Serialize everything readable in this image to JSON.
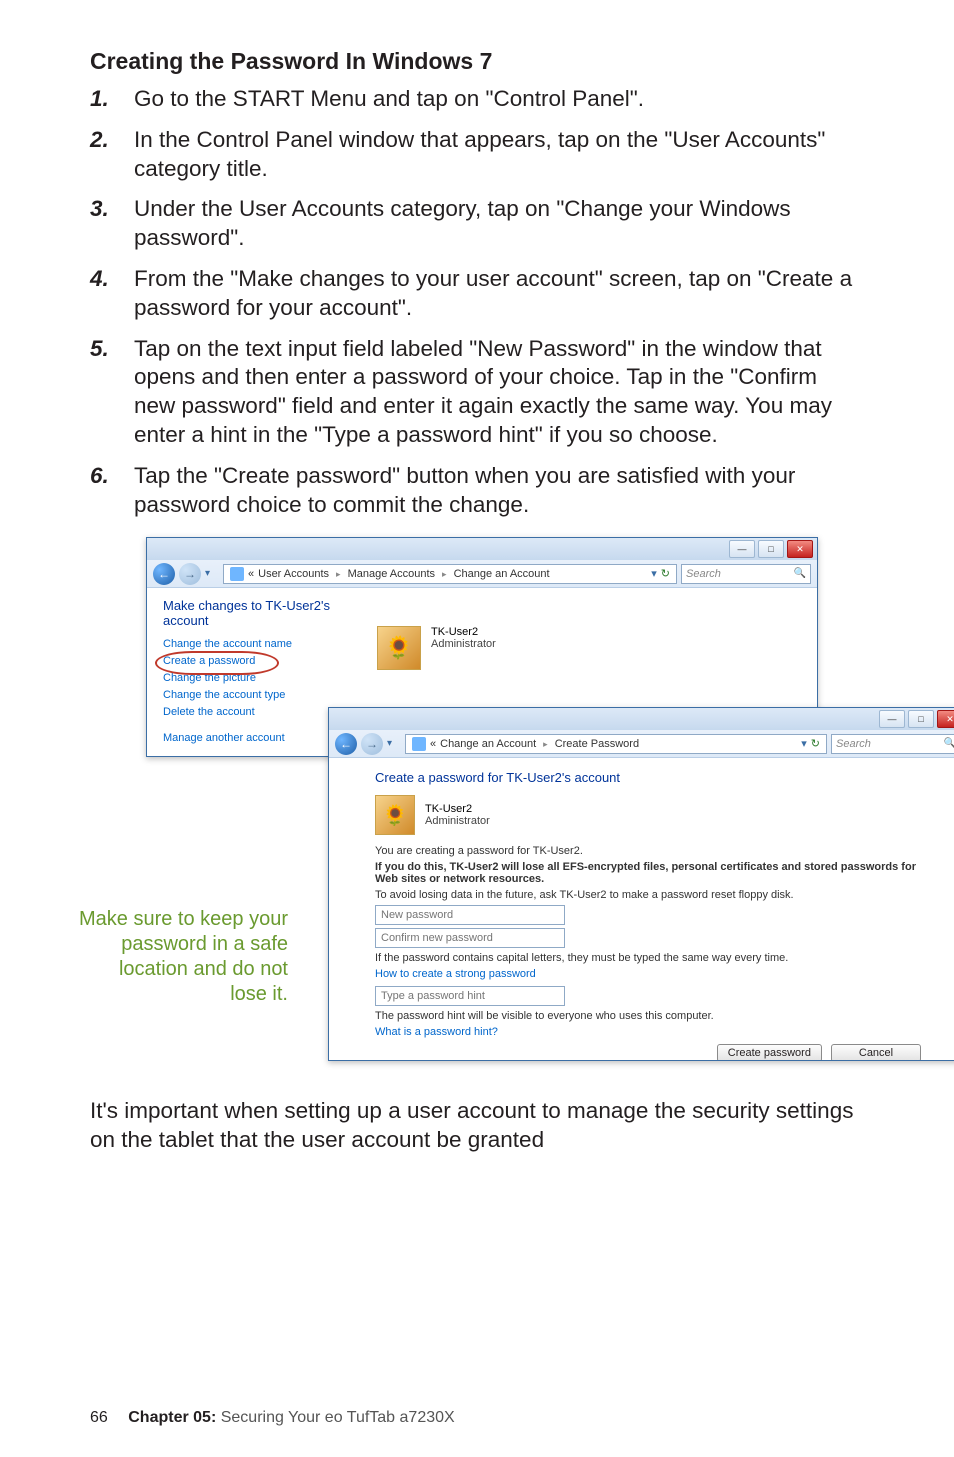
{
  "heading": "Creating the Password In Windows 7",
  "steps": [
    "Go to the START Menu and tap on \"Control Panel\".",
    "In the Control Panel window that appears, tap on the \"User Accounts\" category title.",
    "Under the User Accounts category, tap on \"Change your Windows password\".",
    "From the \"Make changes to your user account\" screen, tap on \"Create a password for your account\".",
    "Tap on the text input field labeled \"New Password\" in the window that opens and then enter a password of your choice. Tap in the \"Confirm new password\" field and enter it again exactly the same way. You may enter a hint in the \"Type a password hint\" if you so choose.",
    "Tap the \"Create password\" button when you are satisfied with your password choice to commit the change."
  ],
  "win1": {
    "breadcrumb": [
      "User Accounts",
      "Manage Accounts",
      "Change an Account"
    ],
    "search_placeholder": "Search",
    "panel_title": "Make changes to TK-User2's account",
    "links": [
      "Change the account name",
      "Create a password",
      "Change the picture",
      "Change the account type",
      "Delete the account",
      "Manage another account"
    ],
    "user": {
      "name": "TK-User2",
      "role": "Administrator"
    }
  },
  "win2": {
    "breadcrumb": [
      "Change an Account",
      "Create Password"
    ],
    "search_placeholder": "Search",
    "title": "Create a password for TK-User2's account",
    "user": {
      "name": "TK-User2",
      "role": "Administrator"
    },
    "line1": "You are creating a password for TK-User2.",
    "line2": "If you do this, TK-User2 will lose all EFS-encrypted files, personal certificates and stored passwords for Web sites or network resources.",
    "line3": "To avoid losing data in the future, ask TK-User2 to make a password reset floppy disk.",
    "ph_new": "New password",
    "ph_confirm": "Confirm new password",
    "caption_caps": "If the password contains capital letters, they must be typed the same way every time.",
    "link_strong": "How to create a strong password",
    "ph_hint": "Type a password hint",
    "caption_hint": "The password hint will be visible to everyone who uses this computer.",
    "link_whathint": "What is a password hint?",
    "btn_create": "Create password",
    "btn_cancel": "Cancel"
  },
  "callout": "Make sure to keep your password in a safe location and do not lose it.",
  "aftertext": "It's important when setting up a user account to manage the security settings on the tablet that the user account be granted",
  "footer": {
    "page": "66",
    "chapter": "Chapter 05:",
    "title": " Securing Your eo TufTab a7230X"
  }
}
